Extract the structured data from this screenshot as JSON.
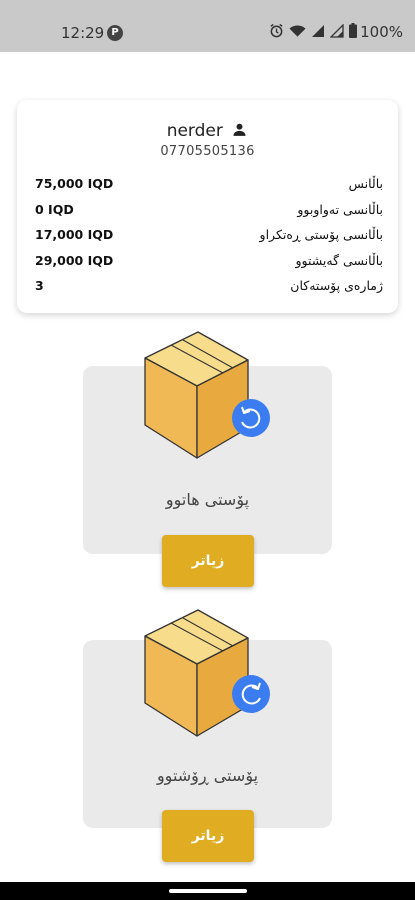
{
  "status_bar": {
    "time": "12:29",
    "app_icon_letter": "P",
    "battery_percent": "100%"
  },
  "user": {
    "name": "nerder",
    "phone": "07705505136"
  },
  "summary": [
    {
      "label": "باڵانس",
      "value": "75,000 IQD"
    },
    {
      "label": "باڵانسی تەواوبوو",
      "value": "0 IQD"
    },
    {
      "label": "باڵانسی پۆستی ڕەتکراو",
      "value": "17,000 IQD"
    },
    {
      "label": "باڵانسی گەیشتوو",
      "value": "29,000 IQD"
    },
    {
      "label": "ژمارەی پۆستەکان",
      "value": "3"
    }
  ],
  "panels": [
    {
      "title": "پۆستی هاتوو",
      "button_label": "زیاتر"
    },
    {
      "title": "پۆستی ڕۆشتوو",
      "button_label": "زیاتر"
    }
  ],
  "colors": {
    "accent": "#e0ac21",
    "badge_blue": "#3b7df0",
    "box_yellow": "#f0b955",
    "panel_bg": "#eaeaea",
    "status_bar_bg": "#c9c9c9"
  },
  "icons": {
    "user": "person-icon",
    "incoming_badge": "rotate-ccw-icon",
    "outgoing_badge": "rotate-cw-icon"
  }
}
